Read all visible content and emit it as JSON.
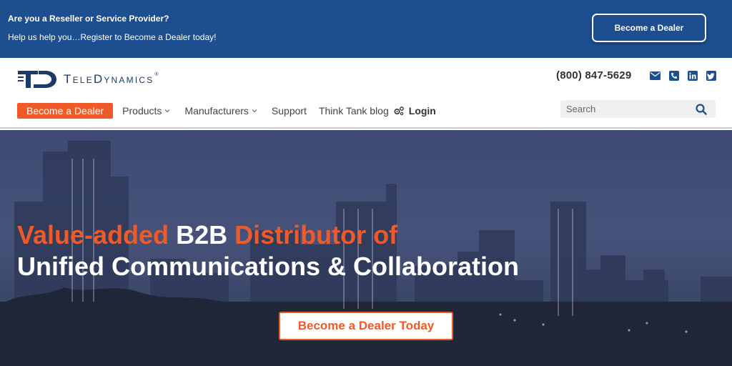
{
  "promo": {
    "question": "Are you a Reseller or Service Provider?",
    "tagline": "Help us help you…Register to Become a Dealer today!",
    "button_label": "Become a Dealer"
  },
  "header": {
    "logo_text": "TeleDynamics",
    "logo_reg": "®",
    "phone": "(800) 847-5629",
    "socials": [
      "envelope-icon",
      "phone-icon",
      "linkedin-icon",
      "twitter-icon"
    ]
  },
  "nav": {
    "cta_label": "Become a Dealer",
    "items": [
      {
        "label": "Products",
        "dropdown": true
      },
      {
        "label": "Manufacturers",
        "dropdown": true
      },
      {
        "label": "Support",
        "dropdown": false
      },
      {
        "label": "Think Tank blog",
        "dropdown": false
      }
    ],
    "login_label": "Login"
  },
  "search": {
    "placeholder": "Search"
  },
  "hero": {
    "line1_a": "Value-added ",
    "line1_b": "B2B",
    "line1_c": " Distributor of",
    "line2": "Unified Communications & Collaboration",
    "cta_label": "Become a Dealer Today"
  },
  "colors": {
    "brand_blue": "#1d4e8f",
    "accent_orange": "#f05a28",
    "logo_navy": "#1b3a66"
  }
}
